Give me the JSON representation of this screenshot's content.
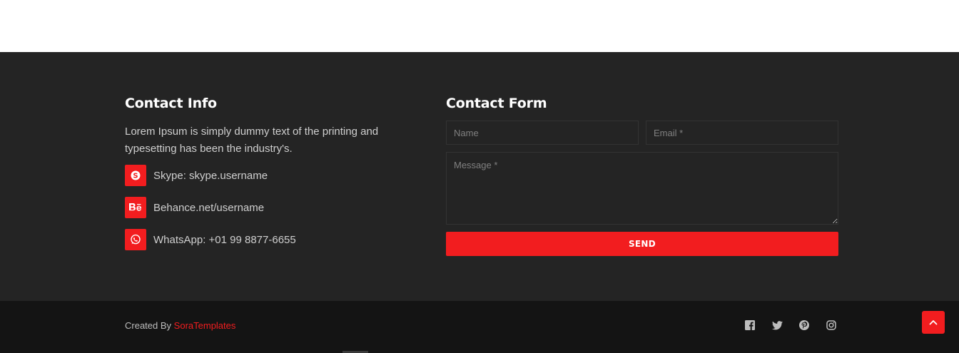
{
  "contact_info": {
    "title": "Contact Info",
    "description": "Lorem Ipsum is simply dummy text of the printing and typesetting has been the industry's.",
    "items": [
      {
        "icon": "skype-icon",
        "label": "Skype: skype.username"
      },
      {
        "icon": "behance-icon",
        "label": "Behance.net/username"
      },
      {
        "icon": "whatsapp-icon",
        "label": "WhatsApp: +01 99 8877-6655"
      }
    ]
  },
  "contact_form": {
    "title": "Contact Form",
    "name_placeholder": "Name",
    "email_placeholder": "Email *",
    "message_placeholder": "Message *",
    "send_label": "SEND"
  },
  "footer": {
    "credit_prefix": "Created By",
    "credit_link": "SoraTemplates",
    "socials": [
      "facebook-icon",
      "twitter-icon",
      "pinterest-icon",
      "instagram-icon"
    ]
  },
  "colors": {
    "accent": "#f21d1f",
    "section_bg": "#242424",
    "bottom_bg": "#141414",
    "text": "#cfcfcf",
    "heading": "#ffffff"
  }
}
